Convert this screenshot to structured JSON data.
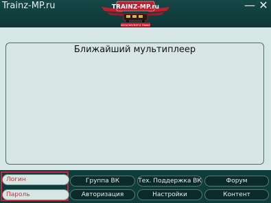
{
  "window": {
    "title": "Trainz-MP.ru",
    "minimize_glyph": "—",
    "close_glyph": "✕"
  },
  "logo": {
    "text": "TRAINZ-MP.ru",
    "subtitle": "МУЛЬТИПЛЕЕР В TRAINZ",
    "colors": {
      "banner": "#c01e2e",
      "text": "#ffffff"
    }
  },
  "main": {
    "title": "Ближайший мультиплеер"
  },
  "login": {
    "login_placeholder": "Логин",
    "password_placeholder": "Пароль"
  },
  "buttons": {
    "vk_group": "Группа ВК",
    "tech_support_vk": "Тех. Поддержка ВК",
    "forum": "Форум",
    "authorization": "Авторизация",
    "settings": "Настройки",
    "content": "Контент"
  },
  "colors": {
    "window_bg": "#0f3d3c",
    "panel_bg": "#d6e6e4",
    "highlight_border": "#d0223a",
    "button_bg": "#0b2b2a"
  }
}
